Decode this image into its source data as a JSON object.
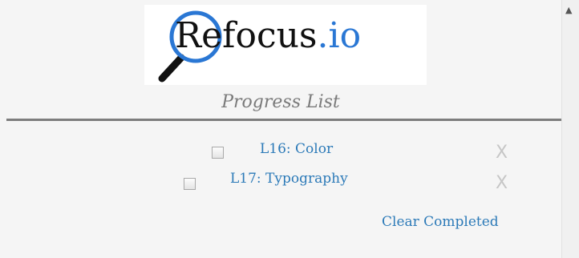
{
  "logo": {
    "letter": "R",
    "text": "efocus",
    "suffix": ".io"
  },
  "progress": {
    "title": "Progress List",
    "items": [
      {
        "label": "L16: Color",
        "checked": false,
        "remove": "X"
      },
      {
        "label": "L17: Typography",
        "checked": false,
        "remove": "X"
      }
    ],
    "clear_label": "Clear Completed"
  },
  "scrollbar": {
    "up_arrow": "▲"
  },
  "colors": {
    "link": "#2c7ab8",
    "brand_blue": "#2a77d4",
    "title_gray": "#7a7a7a",
    "divider": "#7d7d7d"
  }
}
